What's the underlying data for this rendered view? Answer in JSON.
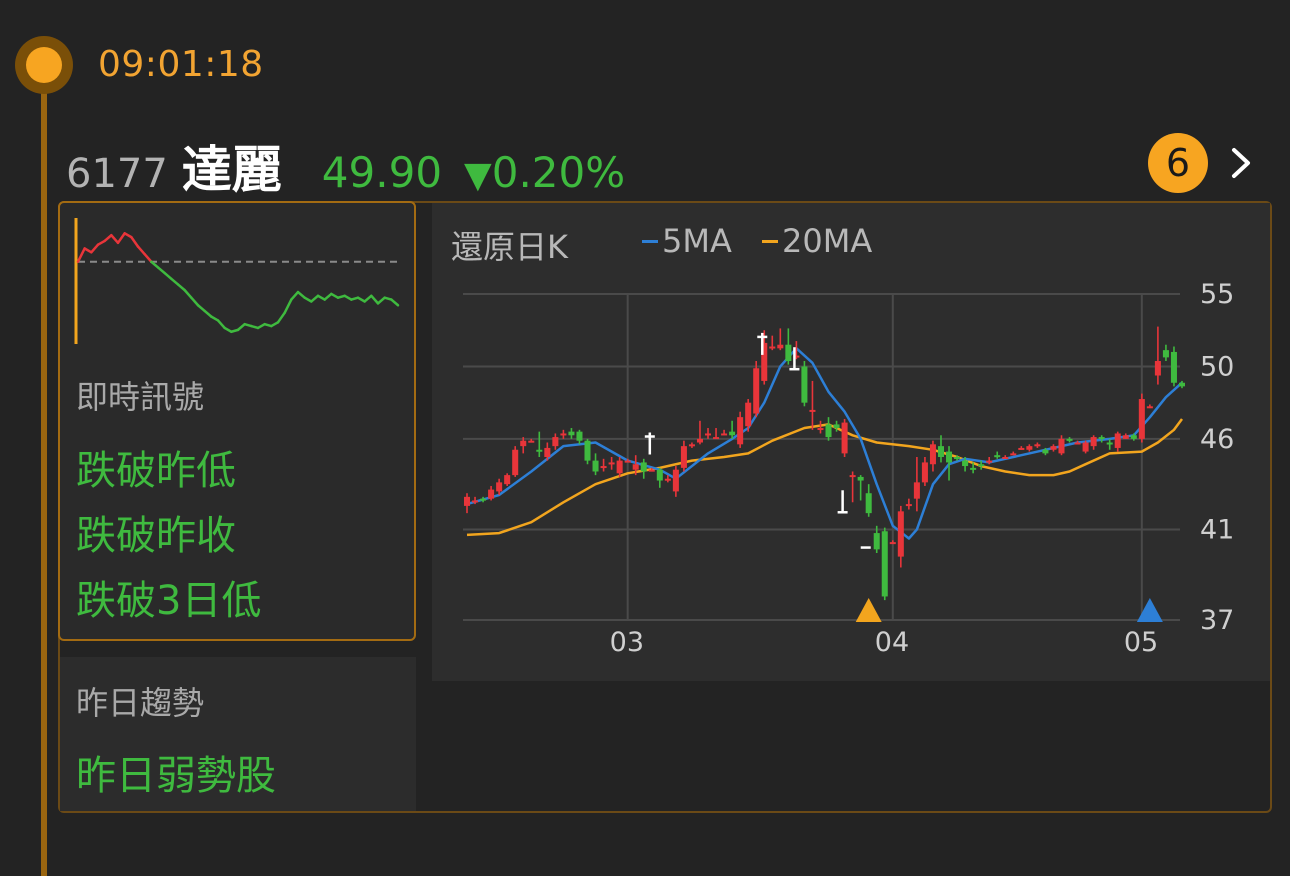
{
  "header": {
    "time": "09:01:18",
    "count_badge": "6"
  },
  "stock": {
    "code": "6177",
    "name": "達麗",
    "price": "49.90",
    "change_symbol": "▼",
    "change": "0.20%"
  },
  "signals": {
    "section_title": "即時訊號",
    "items": [
      "跌破昨低",
      "跌破昨收",
      "跌破3日低"
    ]
  },
  "trend": {
    "section_title": "昨日趨勢",
    "value": "昨日弱勢股"
  },
  "colors": {
    "accent": "#f7a521",
    "up": "#e8353a",
    "down": "#3fba3f",
    "ma5": "#2d7fd6",
    "ma20": "#f2a51e"
  },
  "icons": {
    "chevron": "chevron-right-icon"
  },
  "intraday": {
    "baseline": 49.9,
    "series": [
      49.9,
      50.6,
      50.4,
      50.8,
      51.0,
      51.3,
      50.9,
      51.4,
      51.2,
      50.7,
      50.3,
      49.9,
      49.6,
      49.3,
      49.0,
      48.7,
      48.4,
      48.0,
      47.6,
      47.3,
      47.0,
      46.8,
      46.4,
      46.2,
      46.3,
      46.6,
      46.5,
      46.4,
      46.6,
      46.5,
      46.7,
      47.2,
      47.9,
      48.3,
      48.0,
      47.8,
      48.1,
      47.9,
      48.2,
      48.0,
      48.1,
      47.9,
      48.0,
      47.8,
      48.1,
      47.7,
      48.0,
      47.9,
      47.6
    ]
  },
  "chart_data": {
    "type": "candlestick",
    "title": "還原日K",
    "legend": [
      "5MA",
      "20MA"
    ],
    "yticks": [
      55,
      50,
      46,
      41,
      37
    ],
    "ylim": [
      37,
      55
    ],
    "xticks": [
      {
        "label": "03",
        "index": 20
      },
      {
        "label": "04",
        "index": 53
      },
      {
        "label": "05",
        "index": 84
      }
    ],
    "n": 90,
    "candles": [
      [
        0,
        43.3,
        43.8,
        42.9,
        44.0
      ],
      [
        1,
        43.6,
        43.6,
        43.4,
        43.8
      ],
      [
        2,
        43.7,
        43.6,
        43.5,
        43.8
      ],
      [
        3,
        43.7,
        44.2,
        43.6,
        44.4
      ],
      [
        4,
        44.1,
        44.6,
        43.9,
        44.8
      ],
      [
        5,
        44.5,
        45.0,
        44.4,
        45.1
      ],
      [
        6,
        45.0,
        46.4,
        44.9,
        46.6
      ],
      [
        7,
        46.6,
        46.9,
        46.2,
        47.1
      ],
      [
        8,
        46.9,
        46.9,
        46.8,
        47.0
      ],
      [
        9,
        46.4,
        46.3,
        46.0,
        47.4
      ],
      [
        10,
        46.0,
        46.5,
        45.8,
        46.8
      ],
      [
        11,
        46.6,
        47.1,
        46.4,
        47.3
      ],
      [
        12,
        47.2,
        47.3,
        47.0,
        47.5
      ],
      [
        13,
        47.4,
        47.2,
        47.0,
        47.6
      ],
      [
        14,
        47.4,
        46.9,
        46.7,
        47.5
      ],
      [
        15,
        46.9,
        45.8,
        45.6,
        47.0
      ],
      [
        16,
        45.8,
        45.2,
        45.0,
        46.2
      ],
      [
        17,
        45.4,
        45.5,
        45.2,
        45.9
      ],
      [
        18,
        45.6,
        45.7,
        45.3,
        46.0
      ],
      [
        19,
        45.1,
        45.8,
        44.9,
        46.0
      ],
      [
        20,
        45.8,
        45.8,
        45.7,
        45.9
      ],
      [
        21,
        45.3,
        45.6,
        45.0,
        46.1
      ],
      [
        22,
        45.7,
        45.2,
        44.8,
        45.9
      ],
      [
        23,
        45.3,
        45.3,
        45.2,
        45.4
      ],
      [
        24,
        45.3,
        44.7,
        44.3,
        45.4
      ],
      [
        25,
        44.8,
        44.8,
        44.6,
        45.0
      ],
      [
        26,
        44.1,
        45.3,
        43.8,
        45.5
      ],
      [
        27,
        45.4,
        46.6,
        45.2,
        46.9
      ],
      [
        28,
        46.6,
        46.7,
        46.5,
        46.8
      ],
      [
        29,
        46.8,
        47.0,
        46.7,
        48.0
      ],
      [
        30,
        47.2,
        47.3,
        47.0,
        47.6
      ],
      [
        31,
        47.1,
        47.1,
        47.0,
        47.6
      ],
      [
        32,
        47.3,
        47.3,
        47.2,
        47.5
      ],
      [
        33,
        47.4,
        47.2,
        47.0,
        48.0
      ],
      [
        34,
        46.7,
        48.2,
        46.5,
        48.5
      ],
      [
        35,
        47.7,
        49.0,
        47.4,
        49.2
      ],
      [
        36,
        48.4,
        50.9,
        48.2,
        51.3
      ],
      [
        37,
        50.2,
        52.3,
        50.0,
        53.0
      ],
      [
        38,
        52.0,
        52.1,
        51.9,
        52.7
      ],
      [
        39,
        52.0,
        52.2,
        51.9,
        53.1
      ],
      [
        40,
        52.2,
        51.3,
        51.1,
        53.1
      ],
      [
        41,
        51.6,
        51.6,
        51.4,
        52.4
      ],
      [
        42,
        51.0,
        49.0,
        48.8,
        51.3
      ],
      [
        43,
        48.6,
        48.6,
        47.5,
        50.2
      ],
      [
        44,
        47.5,
        47.6,
        47.3,
        48.0
      ],
      [
        45,
        47.8,
        47.1,
        46.9,
        48.2
      ],
      [
        46,
        47.8,
        47.6,
        47.4,
        48.0
      ],
      [
        47,
        46.2,
        47.9,
        46.0,
        48.1
      ],
      [
        48,
        45.0,
        45.0,
        43.5,
        45.2
      ],
      [
        49,
        44.9,
        44.7,
        43.6,
        45.0
      ],
      [
        50,
        44.0,
        42.9,
        42.7,
        44.5
      ],
      [
        51,
        41.8,
        40.9,
        40.7,
        42.2
      ],
      [
        52,
        41.9,
        38.3,
        38.1,
        42.1
      ],
      [
        53,
        41.3,
        41.3,
        41.2,
        41.4
      ],
      [
        54,
        40.5,
        43.0,
        39.9,
        43.3
      ],
      [
        55,
        43.3,
        43.4,
        43.1,
        43.7
      ],
      [
        56,
        43.7,
        44.6,
        43.0,
        46.0
      ],
      [
        57,
        44.6,
        45.7,
        44.4,
        46.0
      ],
      [
        58,
        45.6,
        46.7,
        45.2,
        46.9
      ],
      [
        59,
        46.6,
        46.0,
        45.7,
        47.2
      ],
      [
        60,
        46.3,
        45.7,
        44.7,
        46.6
      ],
      [
        61,
        46.0,
        45.9,
        45.8,
        46.1
      ],
      [
        62,
        45.8,
        45.5,
        45.2,
        46.0
      ],
      [
        63,
        45.4,
        45.3,
        45.1,
        45.7
      ],
      [
        64,
        45.6,
        45.5,
        45.3,
        45.8
      ],
      [
        65,
        45.7,
        45.8,
        45.6,
        46.0
      ],
      [
        66,
        46.1,
        46.0,
        45.9,
        46.3
      ],
      [
        67,
        46.0,
        46.0,
        45.9,
        46.1
      ],
      [
        68,
        46.2,
        46.2,
        46.1,
        46.3
      ],
      [
        69,
        46.5,
        46.5,
        46.4,
        46.6
      ],
      [
        70,
        46.4,
        46.6,
        46.3,
        46.7
      ],
      [
        71,
        46.6,
        46.7,
        46.5,
        46.8
      ],
      [
        72,
        46.4,
        46.2,
        46.1,
        46.5
      ],
      [
        73,
        46.4,
        46.6,
        46.3,
        46.7
      ],
      [
        74,
        46.2,
        47.0,
        46.1,
        47.2
      ],
      [
        75,
        47.0,
        46.9,
        46.8,
        47.1
      ],
      [
        76,
        46.8,
        46.8,
        46.7,
        46.9
      ],
      [
        77,
        46.3,
        46.8,
        46.2,
        46.9
      ],
      [
        78,
        46.6,
        47.1,
        46.4,
        47.2
      ],
      [
        79,
        47.1,
        47.0,
        46.8,
        47.2
      ],
      [
        80,
        46.8,
        46.7,
        46.4,
        47.0
      ],
      [
        81,
        46.5,
        47.3,
        46.3,
        47.4
      ],
      [
        82,
        47.0,
        47.2,
        47.0,
        47.3
      ],
      [
        83,
        47.2,
        47.0,
        46.9,
        47.3
      ],
      [
        84,
        47.0,
        49.2,
        46.8,
        49.5
      ],
      [
        85,
        48.8,
        48.8,
        48.7,
        48.9
      ],
      [
        86,
        50.5,
        51.3,
        50.0,
        53.2
      ],
      [
        87,
        51.9,
        51.5,
        51.3,
        52.2
      ],
      [
        88,
        51.8,
        50.1,
        49.9,
        52.1
      ],
      [
        89,
        50.1,
        49.9,
        49.8,
        50.2
      ]
    ],
    "ma5": [
      [
        0,
        43.4
      ],
      [
        4,
        43.9
      ],
      [
        8,
        45.2
      ],
      [
        12,
        46.6
      ],
      [
        16,
        46.8
      ],
      [
        20,
        45.8
      ],
      [
        24,
        45.3
      ],
      [
        26,
        44.8
      ],
      [
        30,
        46.2
      ],
      [
        33,
        47.0
      ],
      [
        35,
        47.6
      ],
      [
        37,
        49.0
      ],
      [
        39,
        51.0
      ],
      [
        41,
        52.0
      ],
      [
        43,
        51.2
      ],
      [
        45,
        49.6
      ],
      [
        47,
        48.5
      ],
      [
        49,
        47.0
      ],
      [
        51,
        44.5
      ],
      [
        53,
        42.2
      ],
      [
        55,
        41.5
      ],
      [
        56,
        42.0
      ],
      [
        58,
        44.5
      ],
      [
        60,
        45.6
      ],
      [
        62,
        45.9
      ],
      [
        65,
        45.7
      ],
      [
        68,
        46.0
      ],
      [
        72,
        46.4
      ],
      [
        76,
        46.8
      ],
      [
        80,
        47.0
      ],
      [
        83,
        47.2
      ],
      [
        85,
        48.2
      ],
      [
        87,
        49.3
      ],
      [
        89,
        50.1
      ]
    ],
    "ma20": [
      [
        0,
        41.7
      ],
      [
        4,
        41.8
      ],
      [
        8,
        42.4
      ],
      [
        12,
        43.5
      ],
      [
        16,
        44.5
      ],
      [
        20,
        45.1
      ],
      [
        24,
        45.4
      ],
      [
        28,
        45.8
      ],
      [
        32,
        46.0
      ],
      [
        35,
        46.2
      ],
      [
        38,
        46.9
      ],
      [
        42,
        47.6
      ],
      [
        45,
        47.8
      ],
      [
        48,
        47.2
      ],
      [
        51,
        46.8
      ],
      [
        55,
        46.6
      ],
      [
        58,
        46.4
      ],
      [
        61,
        46.0
      ],
      [
        64,
        45.5
      ],
      [
        67,
        45.2
      ],
      [
        70,
        45.0
      ],
      [
        73,
        45.0
      ],
      [
        75,
        45.2
      ],
      [
        77,
        45.6
      ],
      [
        80,
        46.2
      ],
      [
        84,
        46.3
      ],
      [
        86,
        46.8
      ],
      [
        88,
        47.5
      ],
      [
        89,
        48.1
      ]
    ],
    "markers": [
      {
        "index": 50,
        "type": "triangle-up",
        "color": "#f2a51e"
      },
      {
        "index": 85,
        "type": "triangle-up",
        "color": "#2d7fd6"
      }
    ],
    "signal_arrows": [
      {
        "index": 38,
        "price": 52.3,
        "dir": "up"
      },
      {
        "index": 42,
        "price": 51.4,
        "dir": "down"
      },
      {
        "index": 48,
        "price": 43.5,
        "dir": "down"
      },
      {
        "index": 51,
        "price": 41.0,
        "dir": "flat"
      },
      {
        "index": 24,
        "price": 46.8,
        "dir": "up"
      }
    ]
  }
}
